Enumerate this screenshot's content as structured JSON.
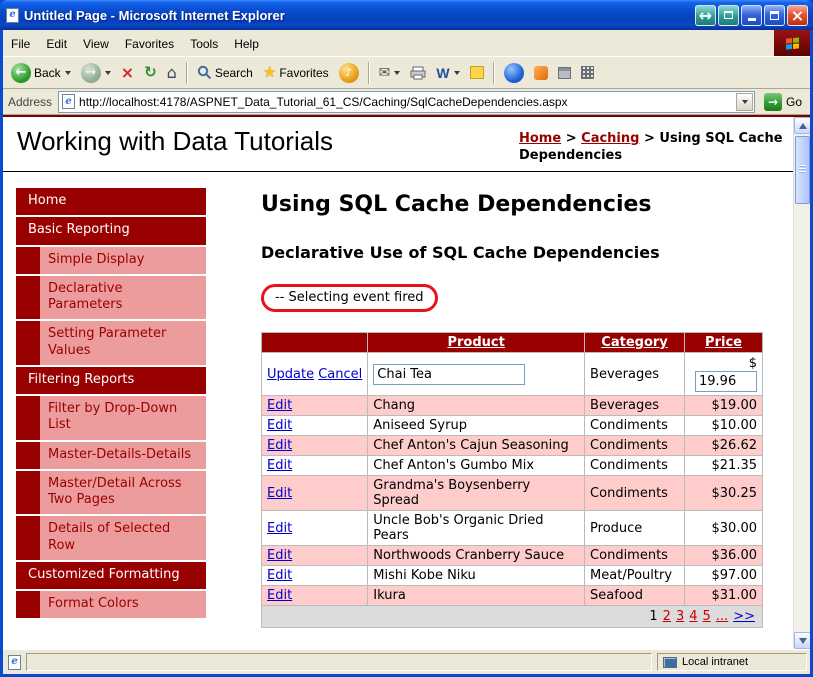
{
  "colors": {
    "maroon": "#990000",
    "sidebar_item_bg": "#EC9C9C",
    "row_pink": "#FFCCCC",
    "link_blue": "#0000CC",
    "pager_link_red": "#CC0000",
    "callout_red": "#E8131B",
    "pager_bg": "#DCDCDC",
    "titlebar_blue": "#0A4ACD"
  },
  "icons": {
    "back_arrow": "←",
    "forward_arrow": "→",
    "stop_x": "×",
    "refresh": "↻",
    "home": "⌂",
    "star": "★",
    "media_note": "♪",
    "mail_envelope": "✉",
    "word_w": "W",
    "go_arrow": "→",
    "close_x": "×",
    "arrows_lr": "↔",
    "ie_e": "e"
  },
  "window": {
    "title": "Untitled Page - Microsoft Internet Explorer",
    "menu_items": [
      "File",
      "Edit",
      "View",
      "Favorites",
      "Tools",
      "Help"
    ],
    "toolbar": {
      "back_label": "Back",
      "search_label": "Search",
      "favorites_label": "Favorites"
    },
    "address_label": "Address",
    "address_url": "http://localhost:4178/ASPNET_Data_Tutorial_61_CS/Caching/SqlCacheDependencies.aspx",
    "go_label": "Go",
    "status_zone": "Local intranet"
  },
  "page": {
    "site_title": "Working with Data Tutorials",
    "breadcrumb": {
      "home": "Home",
      "sep": ">",
      "caching": "Caching",
      "current": "Using SQL Cache Dependencies"
    },
    "sidebar": {
      "items": [
        {
          "label": "Home"
        },
        {
          "label": "Basic Reporting"
        },
        {
          "label": "Simple Display"
        },
        {
          "label": "Declarative Parameters"
        },
        {
          "label": "Setting Parameter Values"
        },
        {
          "label": "Filtering Reports"
        },
        {
          "label": "Filter by Drop-Down List"
        },
        {
          "label": "Master-Details-Details"
        },
        {
          "label": "Master/Detail Across Two Pages"
        },
        {
          "label": "Details of Selected Row"
        },
        {
          "label": "Customized Formatting"
        },
        {
          "label": "Format Colors"
        }
      ]
    },
    "heading": "Using SQL Cache Dependencies",
    "subheading": "Declarative Use of SQL Cache Dependencies",
    "callout": "-- Selecting event fired",
    "grid": {
      "col_action": "",
      "col_product": "Product",
      "col_category": "Category",
      "col_price": "Price",
      "edit_label": "Edit",
      "edit_row": {
        "update": "Update",
        "cancel": "Cancel",
        "product_value": "Chai Tea",
        "category": "Beverages",
        "currency": "$",
        "price_value": "19.96"
      },
      "rows": [
        {
          "product": "Chang",
          "category": "Beverages",
          "price": "$19.00"
        },
        {
          "product": "Aniseed Syrup",
          "category": "Condiments",
          "price": "$10.00"
        },
        {
          "product": "Chef Anton's Cajun Seasoning",
          "category": "Condiments",
          "price": "$26.62"
        },
        {
          "product": "Chef Anton's Gumbo Mix",
          "category": "Condiments",
          "price": "$21.35"
        },
        {
          "product": "Grandma's Boysenberry Spread",
          "category": "Condiments",
          "price": "$30.25"
        },
        {
          "product": "Uncle Bob's Organic Dried Pears",
          "category": "Produce",
          "price": "$30.00"
        },
        {
          "product": "Northwoods Cranberry Sauce",
          "category": "Condiments",
          "price": "$36.00"
        },
        {
          "product": "Mishi Kobe Niku",
          "category": "Meat/Poultry",
          "price": "$97.00"
        },
        {
          "product": "Ikura",
          "category": "Seafood",
          "price": "$31.00"
        }
      ],
      "pager": {
        "current": "1",
        "p2": "2",
        "p3": "3",
        "p4": "4",
        "p5": "5",
        "ellipsis": "...",
        "next": ">>"
      }
    }
  }
}
